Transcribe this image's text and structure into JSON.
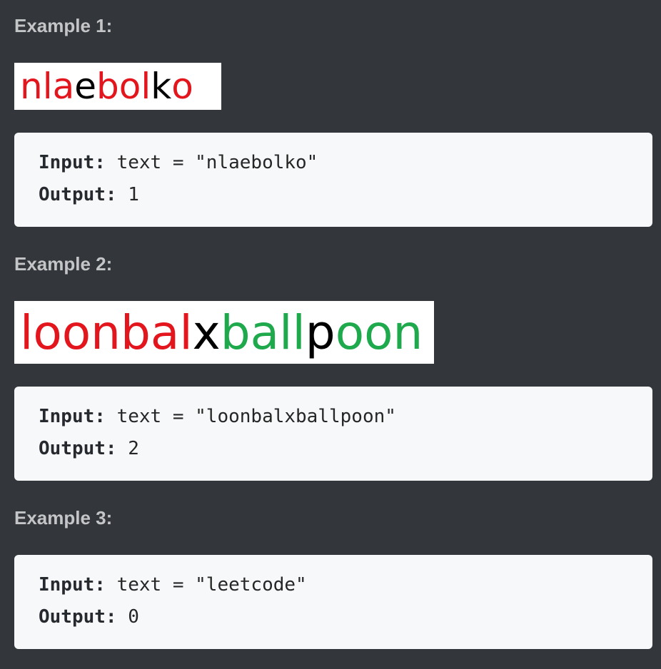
{
  "examples": [
    {
      "heading": "Example 1:",
      "image_letters": [
        {
          "ch": "n",
          "color": "#e3161e"
        },
        {
          "ch": "l",
          "color": "#e3161e"
        },
        {
          "ch": "a",
          "color": "#e3161e"
        },
        {
          "ch": "e",
          "color": "#000000"
        },
        {
          "ch": "b",
          "color": "#e3161e"
        },
        {
          "ch": "o",
          "color": "#e3161e"
        },
        {
          "ch": "l",
          "color": "#e3161e"
        },
        {
          "ch": "k",
          "color": "#000000"
        },
        {
          "ch": "o",
          "color": "#e3161e"
        }
      ],
      "input_label": "Input:",
      "input_value": " text = \"nlaebolko\"",
      "output_label": "Output:",
      "output_value": " 1"
    },
    {
      "heading": "Example 2:",
      "image_letters": [
        {
          "ch": "l",
          "color": "#e3161e"
        },
        {
          "ch": "o",
          "color": "#e3161e"
        },
        {
          "ch": "o",
          "color": "#e3161e"
        },
        {
          "ch": "n",
          "color": "#e3161e"
        },
        {
          "ch": "b",
          "color": "#e3161e"
        },
        {
          "ch": "a",
          "color": "#e3161e"
        },
        {
          "ch": "l",
          "color": "#e3161e"
        },
        {
          "ch": "x",
          "color": "#000000"
        },
        {
          "ch": "b",
          "color": "#1fa94d"
        },
        {
          "ch": "a",
          "color": "#1fa94d"
        },
        {
          "ch": "l",
          "color": "#1fa94d"
        },
        {
          "ch": "l",
          "color": "#1fa94d"
        },
        {
          "ch": "p",
          "color": "#000000"
        },
        {
          "ch": "o",
          "color": "#1fa94d"
        },
        {
          "ch": "o",
          "color": "#1fa94d"
        },
        {
          "ch": "n",
          "color": "#1fa94d"
        }
      ],
      "input_label": "Input:",
      "input_value": " text = \"loonbalxballpoon\"",
      "output_label": "Output:",
      "output_value": " 2"
    },
    {
      "heading": "Example 3:",
      "input_label": "Input:",
      "input_value": " text = \"leetcode\"",
      "output_label": "Output:",
      "output_value": " 0"
    }
  ]
}
